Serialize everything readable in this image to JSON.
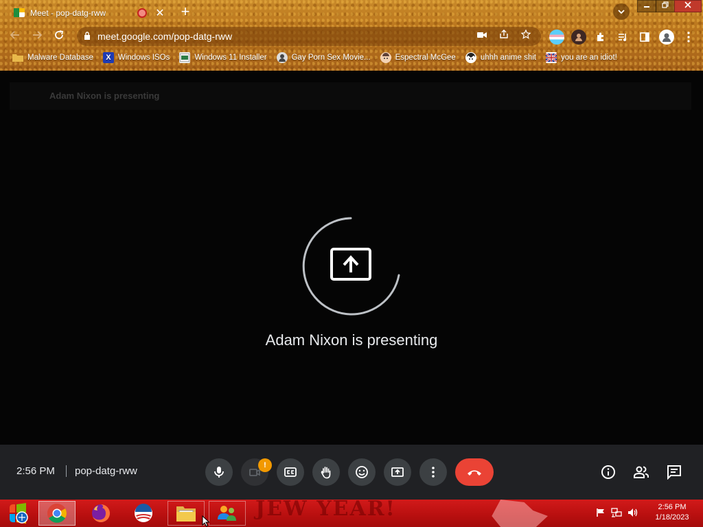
{
  "browser": {
    "tab_title": "Meet - pop-datg-rww",
    "tab_close": "✕",
    "new_tab": "+",
    "url": "meet.google.com/pop-datg-rww",
    "accent": "#b8731c"
  },
  "bookmarks": [
    {
      "label": "Malware Database",
      "icon": "folder-icon",
      "color": "#e0a020"
    },
    {
      "label": "Windows ISOs",
      "icon": "x-logo-icon",
      "color": "#1e3bb3"
    },
    {
      "label": "Windows 11 Installer",
      "icon": "installer-icon",
      "color": "#2d7d46"
    },
    {
      "label": "Gay Porn Sex Movie...",
      "icon": "avatar-icon",
      "color": "#555555"
    },
    {
      "label": "Espectral McGee",
      "icon": "face-icon",
      "color": "#6d4c41"
    },
    {
      "label": "uhhh anime shit",
      "icon": "anime-icon",
      "color": "#333333"
    },
    {
      "label": "you are an idiot!",
      "icon": "flag-icon",
      "color": "#c62828"
    }
  ],
  "meet": {
    "banner_text": "Adam Nixon is presenting",
    "center_text": "Adam Nixon is presenting",
    "time": "2:56 PM",
    "meeting_code": "pop-datg-rww",
    "camera_badge": "!",
    "hangup_color": "#ea4335"
  },
  "taskbar": {
    "wallpaper_text": "JEW YEAR!",
    "clock_time": "2:56 PM",
    "clock_date": "1/18/2023"
  }
}
